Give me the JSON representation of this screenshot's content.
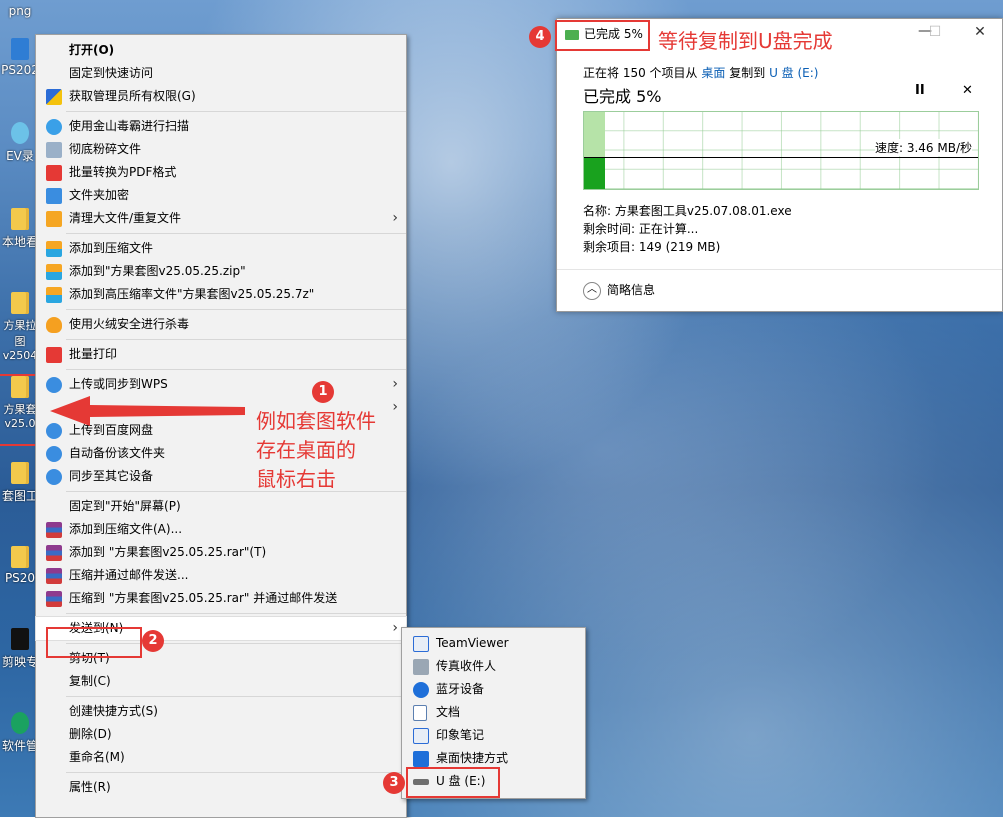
{
  "desktop": {
    "icons": [
      {
        "label": "png"
      },
      {
        "label": "PS202"
      },
      {
        "label": "EV录"
      },
      {
        "label": "本地看"
      },
      {
        "label": "方果拉图 v2504"
      },
      {
        "label": "方果套 v25.0"
      },
      {
        "label": "套图工"
      },
      {
        "label": "PS20"
      },
      {
        "label": "剪映专"
      },
      {
        "label": "软件管"
      }
    ]
  },
  "context_menu": {
    "items": [
      {
        "label": "打开(O)"
      },
      {
        "label": "固定到快速访问"
      },
      {
        "label": "获取管理员所有权限(G)"
      },
      {
        "label": "使用金山毒霸进行扫描"
      },
      {
        "label": "彻底粉碎文件"
      },
      {
        "label": "批量转换为PDF格式"
      },
      {
        "label": "文件夹加密"
      },
      {
        "label": "清理大文件/重复文件"
      },
      {
        "label": "添加到压缩文件"
      },
      {
        "label": "添加到\"方果套图v25.05.25.zip\""
      },
      {
        "label": "添加到高压缩率文件\"方果套图v25.05.25.7z\""
      },
      {
        "label": "使用火绒安全进行杀毒"
      },
      {
        "label": "批量打印"
      },
      {
        "label": "上传或同步到WPS"
      },
      {
        "label": "授予访问权限(G)"
      },
      {
        "label": "上传到百度网盘"
      },
      {
        "label": "自动备份该文件夹"
      },
      {
        "label": "同步至其它设备"
      },
      {
        "label": "固定到\"开始\"屏幕(P)"
      },
      {
        "label": "添加到压缩文件(A)..."
      },
      {
        "label": "添加到 \"方果套图v25.05.25.rar\"(T)"
      },
      {
        "label": "压缩并通过邮件发送..."
      },
      {
        "label": "压缩到 \"方果套图v25.05.25.rar\" 并通过邮件发送"
      },
      {
        "label": "发送到(N)"
      },
      {
        "label": "剪切(T)"
      },
      {
        "label": "复制(C)"
      },
      {
        "label": "创建快捷方式(S)"
      },
      {
        "label": "删除(D)"
      },
      {
        "label": "重命名(M)"
      },
      {
        "label": "属性(R)"
      }
    ]
  },
  "send_to_menu": {
    "items": [
      {
        "label": "TeamViewer"
      },
      {
        "label": "传真收件人"
      },
      {
        "label": "蓝牙设备"
      },
      {
        "label": "文档"
      },
      {
        "label": "印象笔记"
      },
      {
        "label": "桌面快捷方式"
      },
      {
        "label": "U 盘 (E:)"
      }
    ]
  },
  "copy_dialog": {
    "title": "已完成 5%",
    "line_prefix": "正在将 150 个项目从",
    "source": "桌面",
    "line_mid": "复制到",
    "dest": "U 盘 (E:)",
    "percent_text": "已完成 5%",
    "progress_percent": 5,
    "speed": "速度: 3.46 MB/秒",
    "name": "名称: 方果套图工具v25.07.08.01.exe",
    "time_left": "剩余时间: 正在计算...",
    "items_left": "剩余项目: 149 (219 MB)",
    "less_info": "简略信息",
    "pause_icon": "II",
    "close_icon": "✕"
  },
  "annotations": {
    "badge1": "1",
    "badge2": "2",
    "badge3": "3",
    "badge4": "4",
    "note1_line1": "例如套图软件",
    "note1_line2": "存在桌面的",
    "note1_line3": "鼠标右击",
    "note4": "等待复制到U盘完成"
  },
  "colors": {
    "annotation_red": "#e53935",
    "progress_green": "#19a21e",
    "link_blue": "#0b5fb5"
  }
}
